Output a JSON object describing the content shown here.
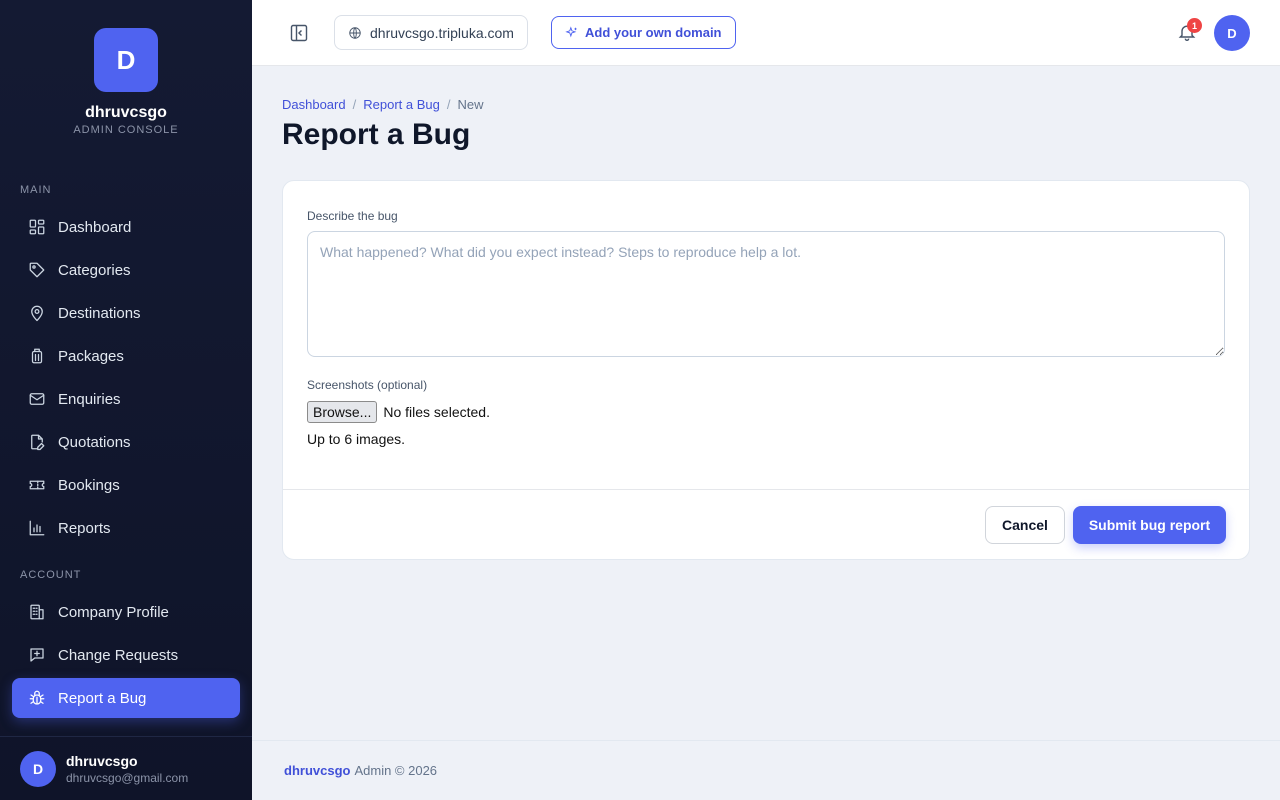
{
  "brand": {
    "initial": "D",
    "name": "dhruvcsgo",
    "subtitle": "ADMIN CONSOLE"
  },
  "sidebar": {
    "main_label": "MAIN",
    "main_items": [
      {
        "label": "Dashboard",
        "icon": "grid-icon"
      },
      {
        "label": "Categories",
        "icon": "tag-icon"
      },
      {
        "label": "Destinations",
        "icon": "map-pin-icon"
      },
      {
        "label": "Packages",
        "icon": "luggage-icon"
      },
      {
        "label": "Enquiries",
        "icon": "mail-icon"
      },
      {
        "label": "Quotations",
        "icon": "file-edit-icon"
      },
      {
        "label": "Bookings",
        "icon": "ticket-icon"
      },
      {
        "label": "Reports",
        "icon": "bar-chart-icon"
      }
    ],
    "account_label": "ACCOUNT",
    "account_items": [
      {
        "label": "Company Profile",
        "icon": "building-icon"
      },
      {
        "label": "Change Requests",
        "icon": "message-plus-icon"
      },
      {
        "label": "Report a Bug",
        "icon": "bug-icon",
        "active": true
      }
    ],
    "user": {
      "initial": "D",
      "name": "dhruvcsgo",
      "email": "dhruvcsgo@gmail.com"
    }
  },
  "topbar": {
    "domain": "dhruvcsgo.tripluka.com",
    "add_domain_label": "Add your own domain",
    "notification_count": "1",
    "avatar_initial": "D"
  },
  "breadcrumb": {
    "items": [
      "Dashboard",
      "Report a Bug"
    ],
    "current": "New"
  },
  "page_title": "Report a Bug",
  "form": {
    "describe_label": "Describe the bug",
    "describe_placeholder": "What happened? What did you expect instead? Steps to reproduce help a lot.",
    "describe_value": "",
    "screenshots_label": "Screenshots (optional)",
    "browse_label": "Browse...",
    "file_status": "No files selected.",
    "file_hint": "Up to 6 images.",
    "cancel_label": "Cancel",
    "submit_label": "Submit bug report"
  },
  "footer": {
    "brand": "dhruvcsgo",
    "text": "Admin © 2026"
  },
  "colors": {
    "accent": "#4f63f0",
    "sidebar_bg": "#141a33",
    "page_bg": "#eef1f7",
    "badge": "#ef4444"
  }
}
